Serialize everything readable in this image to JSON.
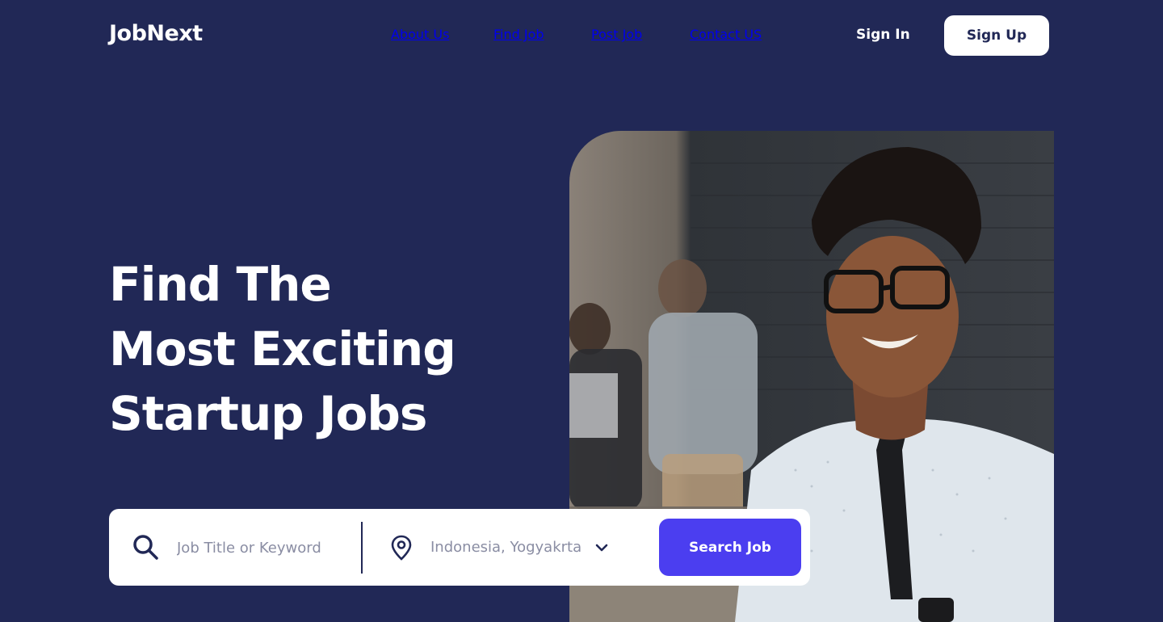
{
  "header": {
    "logo": "JobNext",
    "nav": [
      "About Us",
      "Find Job",
      "Post Job",
      "Contact US"
    ],
    "signin_label": "Sign In",
    "signup_label": "Sign Up"
  },
  "hero": {
    "title_lines": [
      "Find The",
      "Most Exciting",
      "Startup Jobs"
    ]
  },
  "search": {
    "keyword_placeholder": "Job Title or Keyword",
    "location_value": "Indonesia, Yogyakrta",
    "button_label": "Search Job",
    "icons": [
      "search-icon",
      "location-pin-icon",
      "chevron-down-icon"
    ]
  },
  "colors": {
    "background": "#212856",
    "accent": "#4b3ef0",
    "placeholder": "#8a8da3"
  }
}
